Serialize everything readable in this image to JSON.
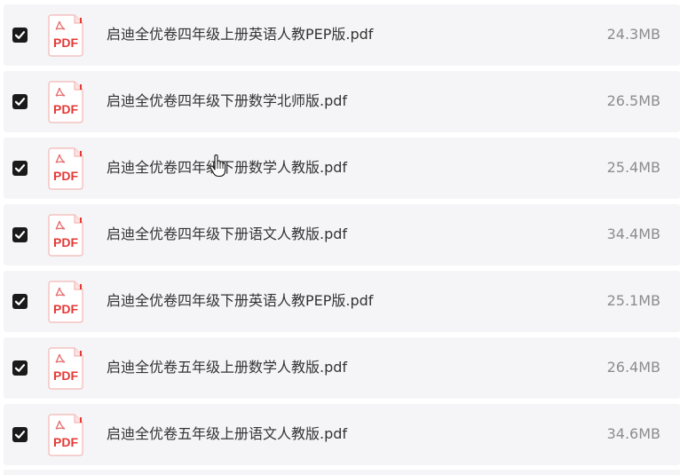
{
  "files": [
    {
      "name": "启迪全优卷四年级上册英语人教PEP版.pdf",
      "size": "24.3MB",
      "checked": true,
      "type_label": "PDF"
    },
    {
      "name": "启迪全优卷四年级下册数学北师版.pdf",
      "size": "26.5MB",
      "checked": true,
      "type_label": "PDF"
    },
    {
      "name": "启迪全优卷四年级下册数学人教版.pdf",
      "size": "25.4MB",
      "checked": true,
      "type_label": "PDF"
    },
    {
      "name": "启迪全优卷四年级下册语文人教版.pdf",
      "size": "34.4MB",
      "checked": true,
      "type_label": "PDF"
    },
    {
      "name": "启迪全优卷四年级下册英语人教PEP版.pdf",
      "size": "25.1MB",
      "checked": true,
      "type_label": "PDF"
    },
    {
      "name": "启迪全优卷五年级上册数学人教版.pdf",
      "size": "26.4MB",
      "checked": true,
      "type_label": "PDF"
    },
    {
      "name": "启迪全优卷五年级上册语文人教版.pdf",
      "size": "34.6MB",
      "checked": true,
      "type_label": "PDF"
    }
  ],
  "colors": {
    "row_bg": "#f5f5f7",
    "checkbox_bg": "#1a1a1a",
    "pdf_red": "#e53935",
    "name_text": "#333333",
    "size_text": "#8c8c8c"
  },
  "icons": {
    "checkbox": "checkbox-checked-icon",
    "file": "pdf-file-icon",
    "cursor": "hand-pointer-icon"
  }
}
